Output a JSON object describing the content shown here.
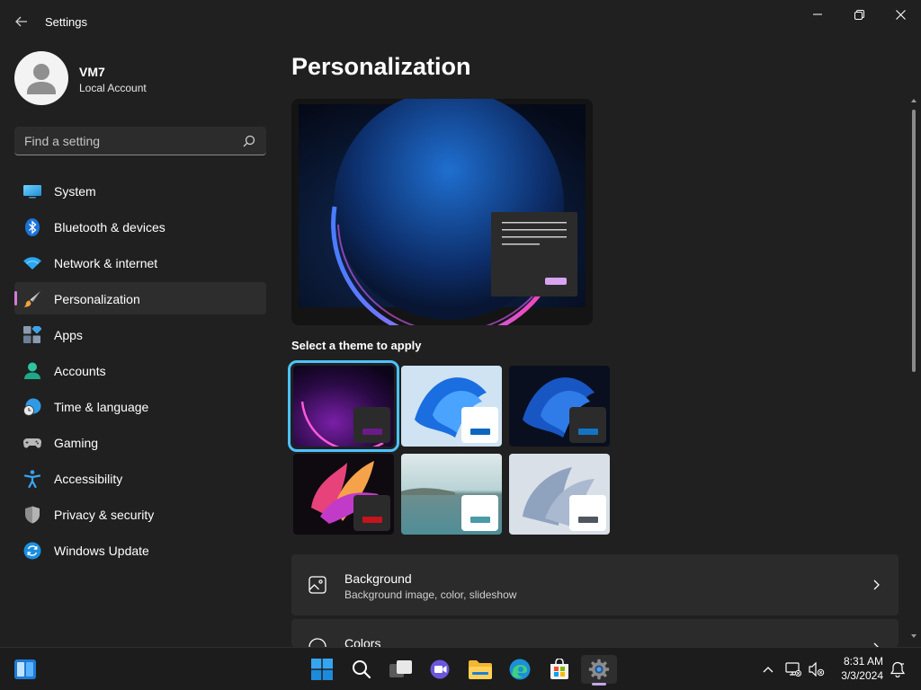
{
  "window": {
    "title": "Settings"
  },
  "profile": {
    "name": "VM7",
    "account_type": "Local Account"
  },
  "search": {
    "placeholder": "Find a setting"
  },
  "nav": {
    "items": [
      {
        "label": "System",
        "icon": "monitor-icon"
      },
      {
        "label": "Bluetooth & devices",
        "icon": "bluetooth-icon"
      },
      {
        "label": "Network & internet",
        "icon": "wifi-icon"
      },
      {
        "label": "Personalization",
        "icon": "paintbrush-icon",
        "active": true
      },
      {
        "label": "Apps",
        "icon": "apps-icon"
      },
      {
        "label": "Accounts",
        "icon": "person-icon"
      },
      {
        "label": "Time & language",
        "icon": "clock-globe-icon"
      },
      {
        "label": "Gaming",
        "icon": "gamepad-icon"
      },
      {
        "label": "Accessibility",
        "icon": "accessibility-icon"
      },
      {
        "label": "Privacy & security",
        "icon": "shield-icon"
      },
      {
        "label": "Windows Update",
        "icon": "update-icon"
      }
    ]
  },
  "main": {
    "title": "Personalization",
    "theme_section_label": "Select a theme to apply",
    "themes": [
      {
        "name": "glow-dark",
        "accent": "#6b1a8a",
        "selected": true
      },
      {
        "name": "bloom-light",
        "accent": "#0a67c2"
      },
      {
        "name": "bloom-dark",
        "accent": "#1474c4"
      },
      {
        "name": "captured-motion",
        "accent": "#c4141e"
      },
      {
        "name": "sunrise-lake",
        "accent": "#4a9aa8"
      },
      {
        "name": "flow",
        "accent": "#50565e"
      }
    ],
    "cards": [
      {
        "title": "Background",
        "subtitle": "Background image, color, slideshow",
        "icon": "image-icon"
      },
      {
        "title": "Colors",
        "subtitle": "",
        "icon": "palette-icon"
      }
    ]
  },
  "taskbar": {
    "time": "8:31 AM",
    "date": "3/3/2024"
  },
  "colors": {
    "accent": "#4cc2ff",
    "nav_indicator": "#d37bd8",
    "background": "#202020",
    "card": "#2b2b2b"
  }
}
